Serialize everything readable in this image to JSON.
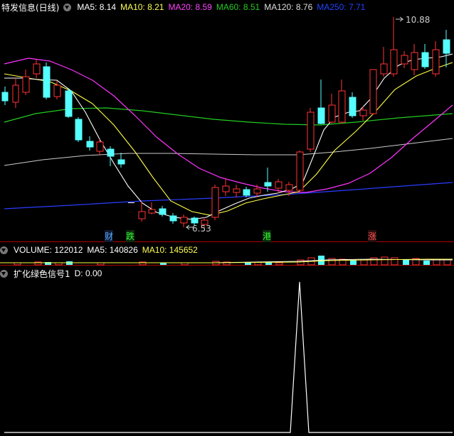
{
  "price_panel": {
    "title": "特发信息(日线)",
    "ma": [
      {
        "label": "MA5: 8.14",
        "color": "#ffffff"
      },
      {
        "label": "MA10: 8.21",
        "color": "#ffff55"
      },
      {
        "label": "MA20: 8.59",
        "color": "#ff44ff"
      },
      {
        "label": "MA60: 8.51",
        "color": "#22cc22"
      },
      {
        "label": "MA120: 8.76",
        "color": "#dddddd"
      },
      {
        "label": "MA250: 7.71",
        "color": "#2244ff"
      }
    ],
    "high_label": "10.88",
    "low_label": "6.53",
    "markers": [
      {
        "text": "财",
        "color": "#55aaff"
      },
      {
        "text": "跌",
        "color": "#33ff33"
      },
      {
        "text": "港",
        "color": "#33ff33"
      },
      {
        "text": "涨",
        "color": "#ff5555"
      }
    ]
  },
  "volume_panel": {
    "ma": [
      {
        "label": "VOLUME: 122012",
        "color": "#ffffff"
      },
      {
        "label": "MA5: 140826",
        "color": "#ffffff"
      },
      {
        "label": "MA10: 145652",
        "color": "#ffff55"
      }
    ]
  },
  "indicator_panel": {
    "title": "扩化绿色信号1",
    "value": "D: 0.00"
  },
  "colors": {
    "up": "#ff3333",
    "down": "#55ffff",
    "separator": "#b00000"
  }
}
